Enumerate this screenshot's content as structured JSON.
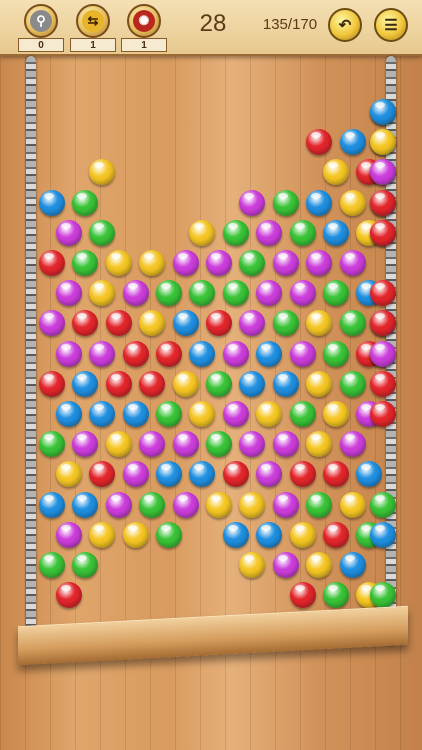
{
  "powerups": [
    {
      "name": "pin-powerup-button",
      "icon": "pin-icon",
      "count": "0"
    },
    {
      "name": "swap-powerup-button",
      "icon": "swap-arrows-icon",
      "count": "1"
    },
    {
      "name": "bomb-powerup-button",
      "icon": "color-bomb-icon",
      "count": "1"
    }
  ],
  "moves": "28",
  "progress": "135/170",
  "colors": {
    "r": "#e3262c",
    "y": "#f5c623",
    "b": "#1f8fe0",
    "g": "#39c337",
    "m": "#cc3ddb"
  },
  "grid": [
    "...........gb",
    "........rbgy",
    ".y......yrgm",
    "bg....mgbyb r",
    "mg..ygmgbymr",
    "rgyymmgmmm",
    "mymgggmmgbr",
    "mrrybrmgygbr",
    "mmrrbmbmgrgm",
    "rbrrygbbygr",
    "bbbgymygymr",
    "gmymmgmmym",
    "yrmbbrmrrb",
    "bbmgmyymgyg",
    "myyg.bbyrgb",
    "gg....ymyb",
    "r......rgyg",
    "........gmb"
  ]
}
